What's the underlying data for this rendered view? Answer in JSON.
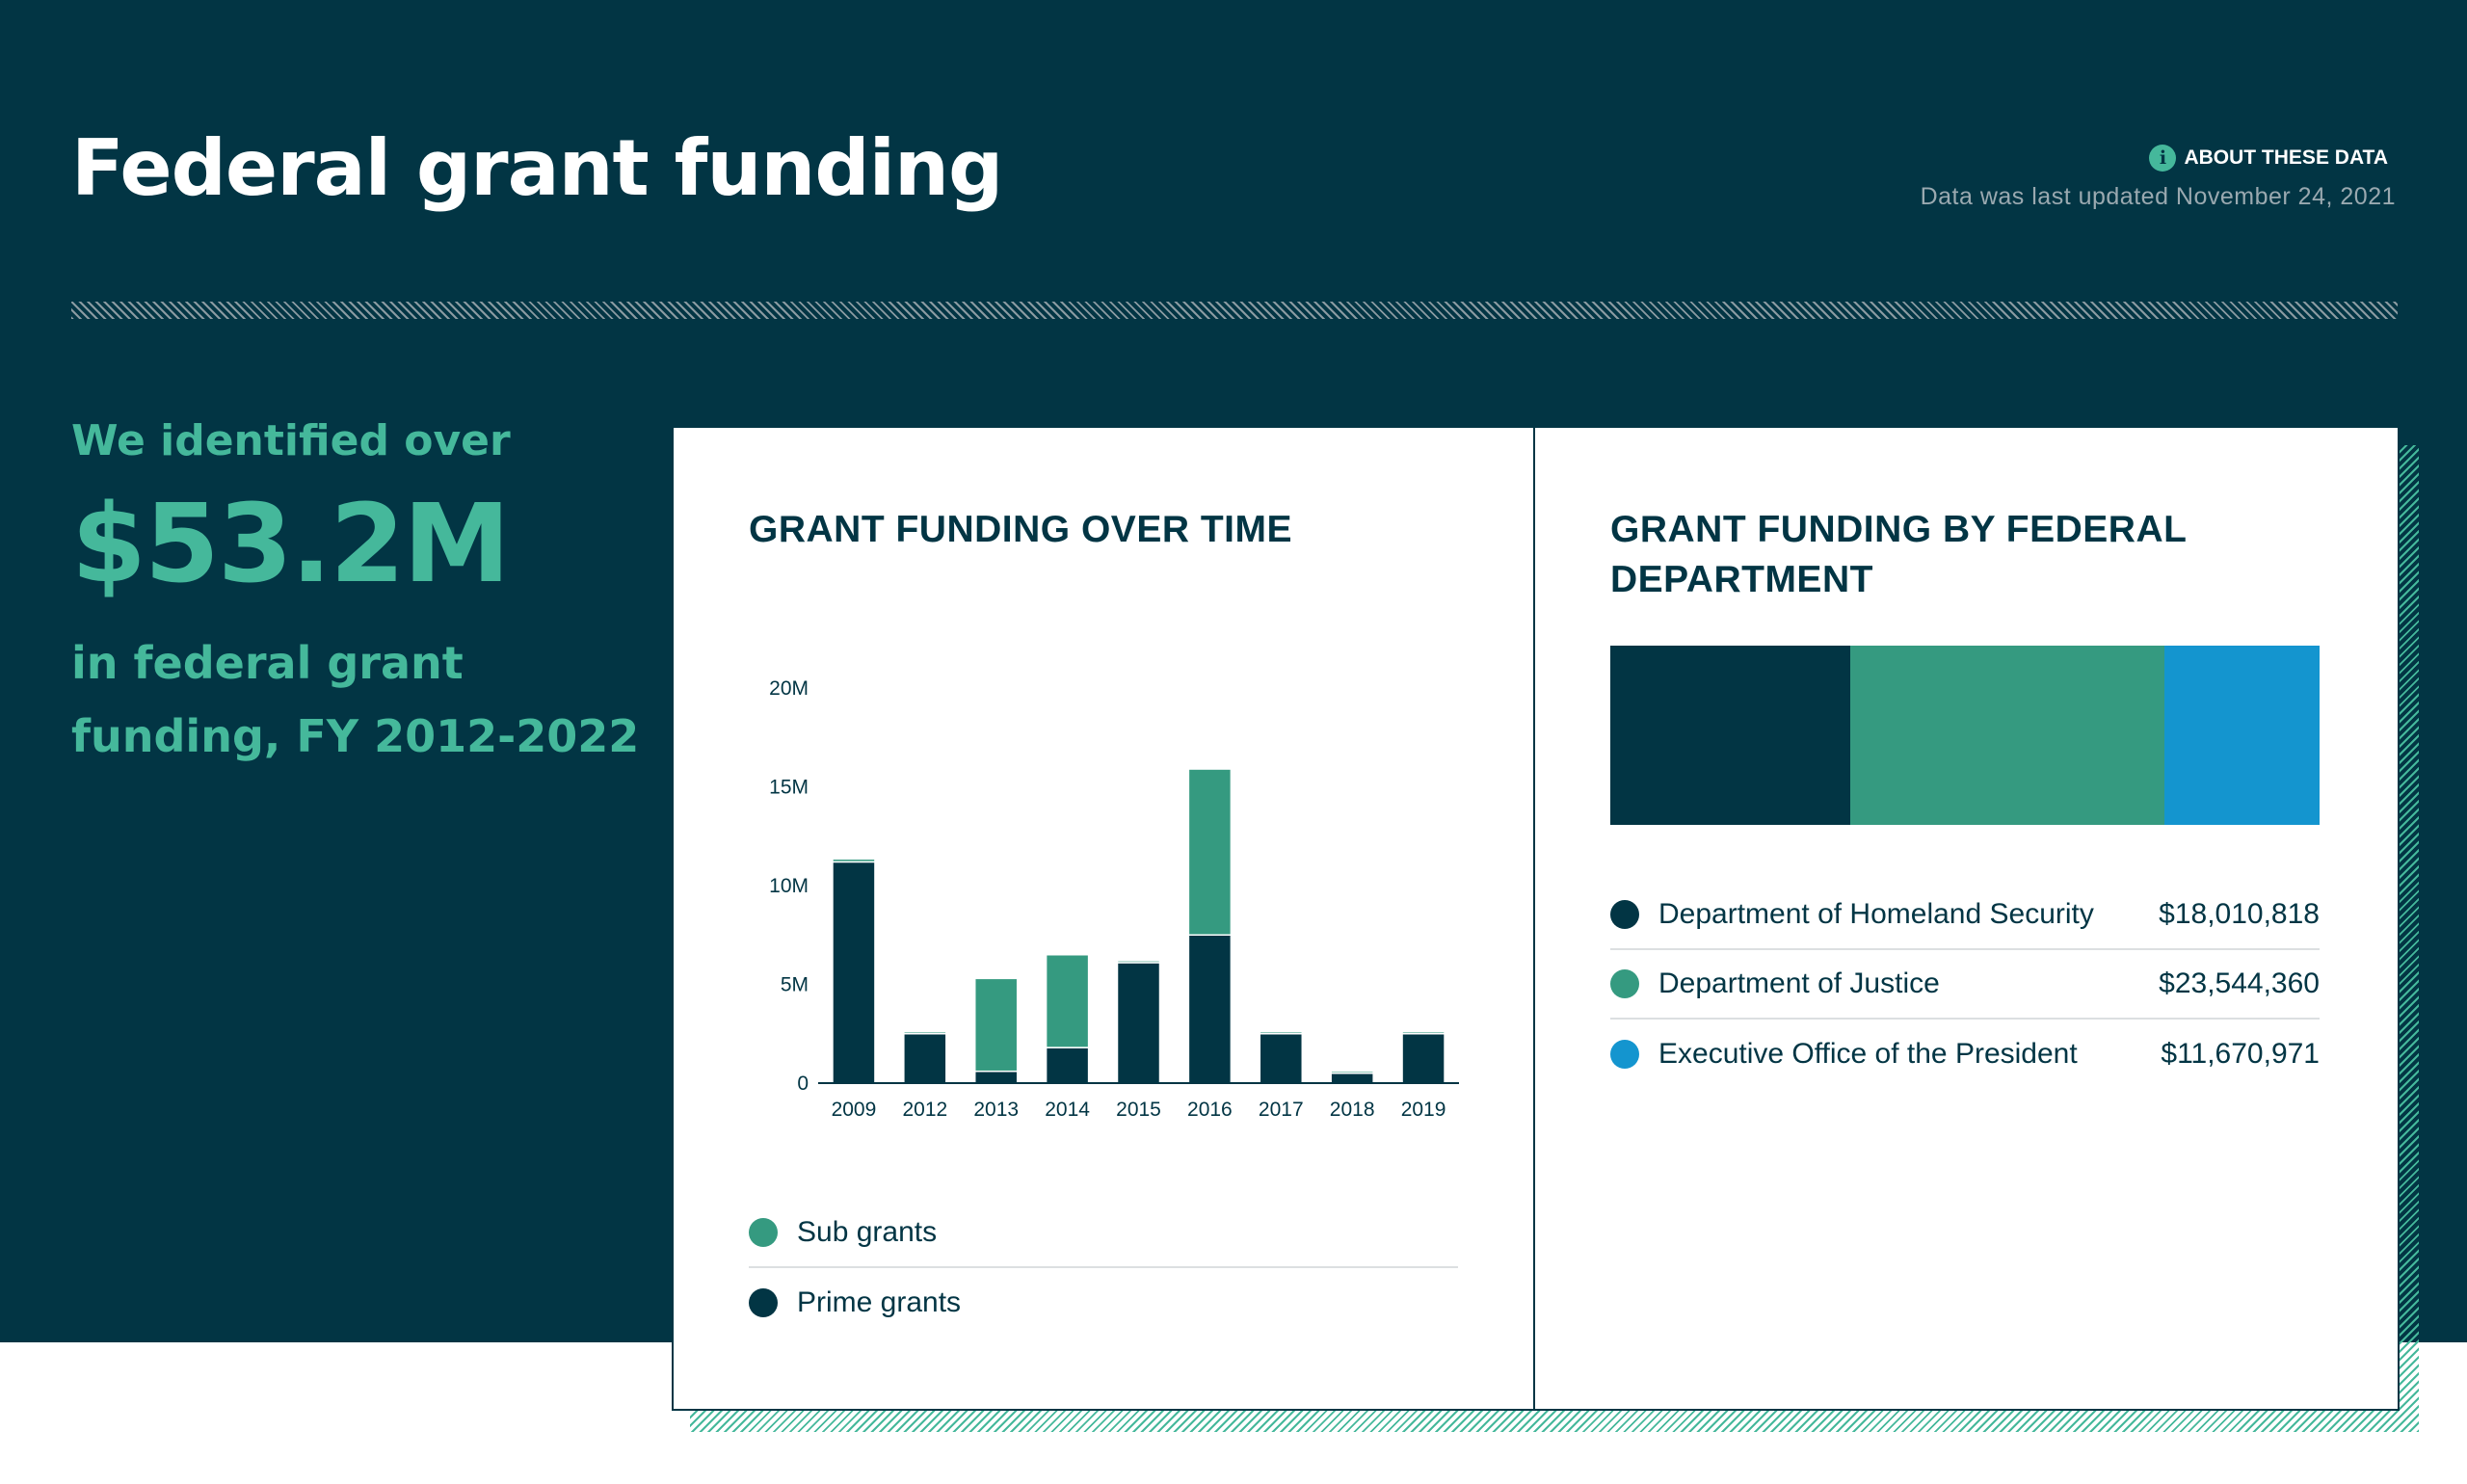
{
  "header": {
    "title": "Federal grant funding",
    "about_label": "ABOUT THESE DATA",
    "info_icon": "i",
    "updated": "Data was last updated November 24, 2021"
  },
  "summary": {
    "lead": "We identified over",
    "amount": "$53.2M",
    "trail": "in federal grant funding, FY 2012-2022"
  },
  "colors": {
    "navy": "#023544",
    "green": "#359a80",
    "blue": "#1495cf",
    "accent": "#45b89b"
  },
  "chart_data": [
    {
      "type": "bar",
      "stacked": true,
      "title": "GRANT FUNDING OVER TIME",
      "categories": [
        "2009",
        "2012",
        "2013",
        "2014",
        "2015",
        "2016",
        "2017",
        "2018",
        "2019"
      ],
      "series": [
        {
          "name": "Prime grants",
          "color": "#023544",
          "values": [
            11.2,
            2.5,
            0.6,
            1.8,
            6.1,
            7.5,
            2.5,
            0.5,
            2.5
          ]
        },
        {
          "name": "Sub grants",
          "color": "#359a80",
          "values": [
            0.15,
            0.1,
            4.7,
            4.7,
            0.1,
            8.4,
            0.1,
            0.1,
            0.1
          ]
        }
      ],
      "yticks": [
        "20M",
        "15M",
        "10M",
        "5M",
        "0"
      ],
      "ylim": [
        0,
        20
      ],
      "grid": false,
      "legend": [
        {
          "name": "Sub grants",
          "color": "#359a80"
        },
        {
          "name": "Prime grants",
          "color": "#023544"
        }
      ],
      "legend_position": "bottom"
    },
    {
      "type": "bar",
      "orientation": "horizontal-stacked",
      "title": "GRANT FUNDING BY FEDERAL DEPARTMENT",
      "categories": [
        "Department of Homeland Security",
        "Department of Justice",
        "Executive Office of the President"
      ],
      "values": [
        18010818,
        23544360,
        11670971
      ],
      "value_labels": [
        "$18,010,818",
        "$23,544,360",
        "$11,670,971"
      ],
      "colors": [
        "#023544",
        "#359a80",
        "#1495cf"
      ],
      "legend_position": "bottom"
    }
  ]
}
